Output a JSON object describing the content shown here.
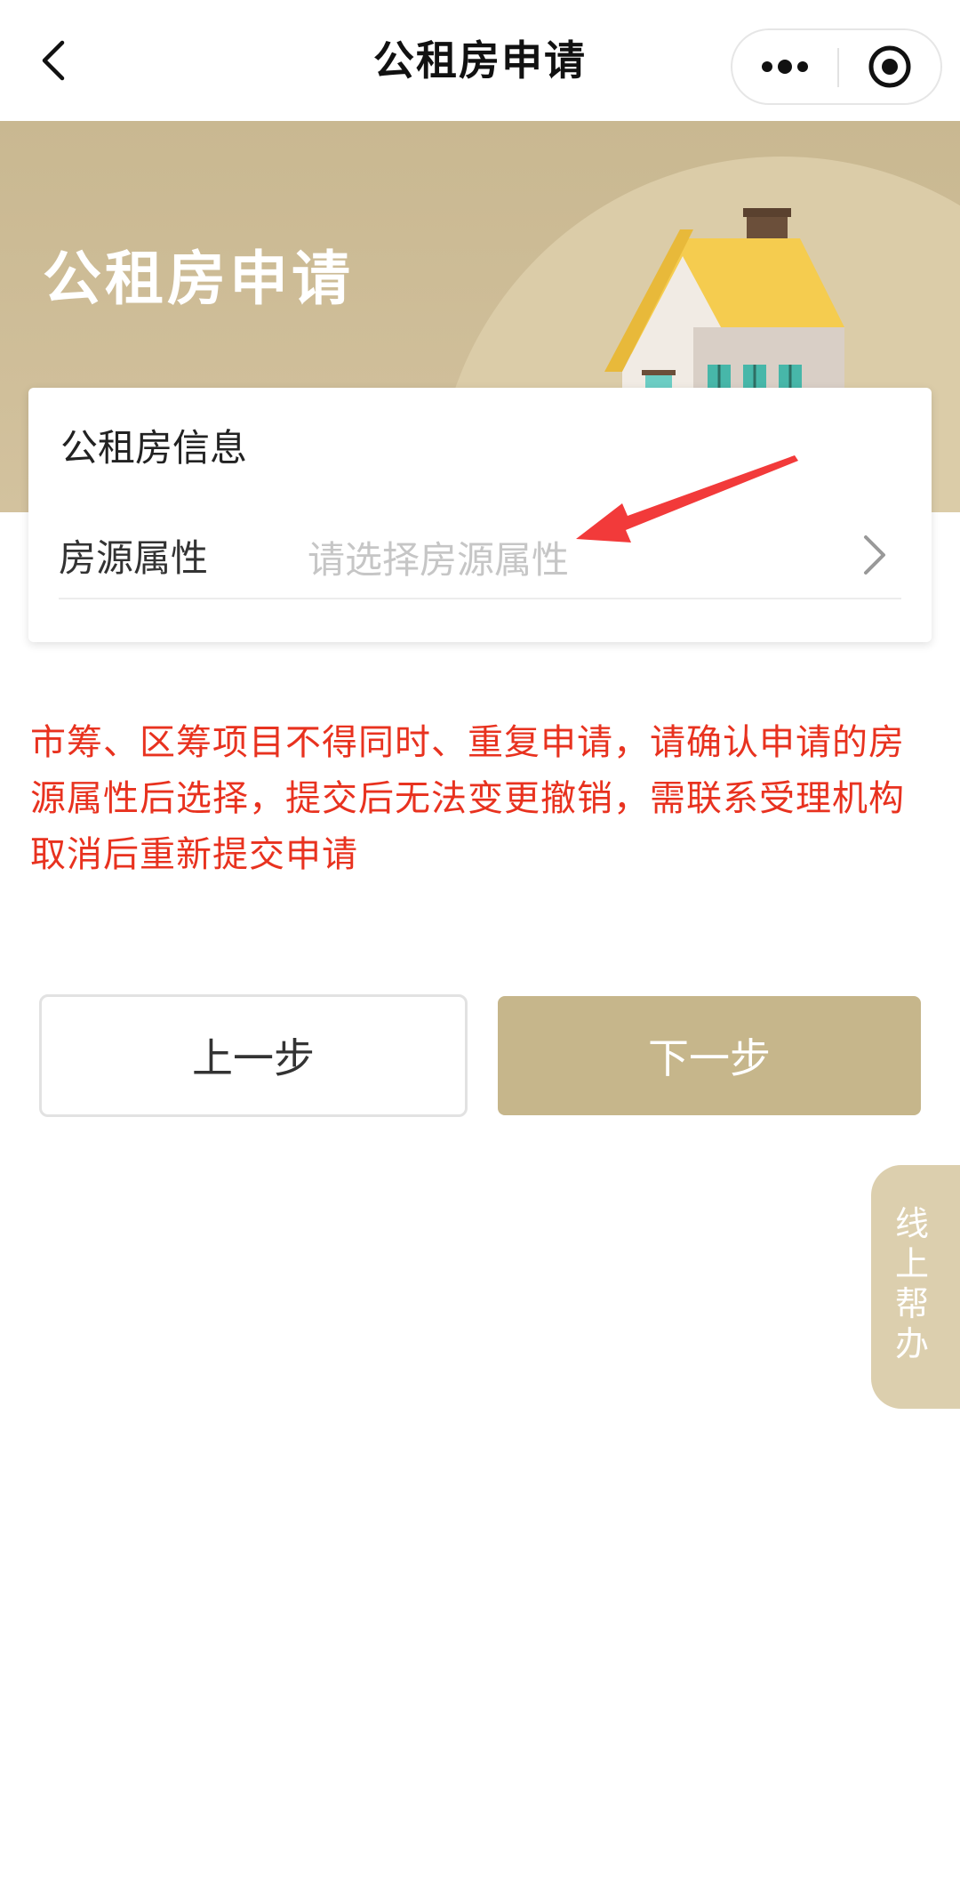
{
  "nav": {
    "title": "公租房申请"
  },
  "banner": {
    "title": "公租房申请"
  },
  "card": {
    "title": "公租房信息",
    "field_label": "房源属性",
    "field_placeholder": "请选择房源属性"
  },
  "warning": "市筹、区筹项目不得同时、重复申请，请确认申请的房源属性后选择，提交后无法变更撤销，需联系受理机构取消后重新提交申请",
  "buttons": {
    "prev": "上一步",
    "next": "下一步"
  },
  "help": {
    "label_lines": [
      "线",
      "上",
      "帮",
      "办"
    ]
  },
  "colors": {
    "accent": "#c6b68b",
    "warning": "#e8321f",
    "banner": "#c9b891"
  }
}
